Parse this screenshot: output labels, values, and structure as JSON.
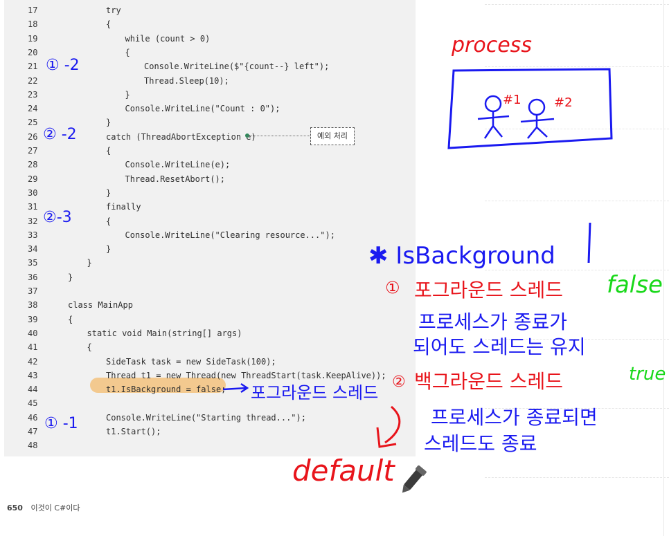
{
  "code_lines": [
    {
      "n": "17",
      "indent": 2,
      "text": "try"
    },
    {
      "n": "18",
      "indent": 2,
      "text": "{"
    },
    {
      "n": "19",
      "indent": 3,
      "text": "while (count > 0)"
    },
    {
      "n": "20",
      "indent": 3,
      "text": "{"
    },
    {
      "n": "21",
      "indent": 4,
      "text": "Console.WriteLine($\"{count--} left\");"
    },
    {
      "n": "22",
      "indent": 4,
      "text": "Thread.Sleep(10);"
    },
    {
      "n": "23",
      "indent": 3,
      "text": "}"
    },
    {
      "n": "24",
      "indent": 3,
      "text": "Console.WriteLine(\"Count : 0\");"
    },
    {
      "n": "25",
      "indent": 2,
      "text": "}"
    },
    {
      "n": "26",
      "indent": 2,
      "text": "catch (ThreadAbortException e)"
    },
    {
      "n": "27",
      "indent": 2,
      "text": "{"
    },
    {
      "n": "28",
      "indent": 3,
      "text": "Console.WriteLine(e);"
    },
    {
      "n": "29",
      "indent": 3,
      "text": "Thread.ResetAbort();"
    },
    {
      "n": "30",
      "indent": 2,
      "text": "}"
    },
    {
      "n": "31",
      "indent": 2,
      "text": "finally"
    },
    {
      "n": "32",
      "indent": 2,
      "text": "{"
    },
    {
      "n": "33",
      "indent": 3,
      "text": "Console.WriteLine(\"Clearing resource...\");"
    },
    {
      "n": "34",
      "indent": 2,
      "text": "}"
    },
    {
      "n": "35",
      "indent": 1,
      "text": "}"
    },
    {
      "n": "36",
      "indent": 0,
      "text": "}"
    },
    {
      "n": "37",
      "indent": 0,
      "text": ""
    },
    {
      "n": "38",
      "indent": 0,
      "text": "class MainApp"
    },
    {
      "n": "39",
      "indent": 0,
      "text": "{"
    },
    {
      "n": "40",
      "indent": 1,
      "text": "static void Main(string[] args)"
    },
    {
      "n": "41",
      "indent": 1,
      "text": "{"
    },
    {
      "n": "42",
      "indent": 2,
      "text": "SideTask task = new SideTask(100);"
    },
    {
      "n": "43",
      "indent": 2,
      "text": "Thread t1 = new Thread(new ThreadStart(task.KeepAlive));"
    },
    {
      "n": "44",
      "indent": 2,
      "text": "t1.IsBackground = false;"
    },
    {
      "n": "45",
      "indent": 0,
      "text": ""
    },
    {
      "n": "46",
      "indent": 2,
      "text": "Console.WriteLine(\"Starting thread...\");"
    },
    {
      "n": "47",
      "indent": 2,
      "text": "t1.Start();"
    },
    {
      "n": "48",
      "indent": 0,
      "text": ""
    }
  ],
  "callout_label": "예외 처리",
  "footer": {
    "page_number": "650",
    "book_title": "이것이 C#이다"
  },
  "handwriting": {
    "mark_21": "① -2",
    "mark_26": "② -2",
    "mark_32": "②-3",
    "mark_47": "① -1",
    "process_title": "process",
    "box_label_1": "#1",
    "box_label_2": "#2",
    "star_title": "✱ IsBackground",
    "item1_num": "①",
    "item1_text": "포그라운드 스레드",
    "item1_value": "false",
    "item1_line2": "프로세스가 종료가",
    "item1_line3": "되어도 스레드는 유지",
    "item2_num": "②",
    "item2_text": "백그라운드 스레드",
    "item2_value": "true",
    "item2_line2": "프로세스가 종료되면",
    "item2_line3": "스레드도 종료",
    "arrow_note": "포그라운드 스레드",
    "default_label": "default"
  },
  "colors": {
    "ink_blue": "#1a1af0",
    "ink_red": "#e8141b",
    "ink_green": "#19d81a",
    "highlight": "#f3c27e"
  }
}
